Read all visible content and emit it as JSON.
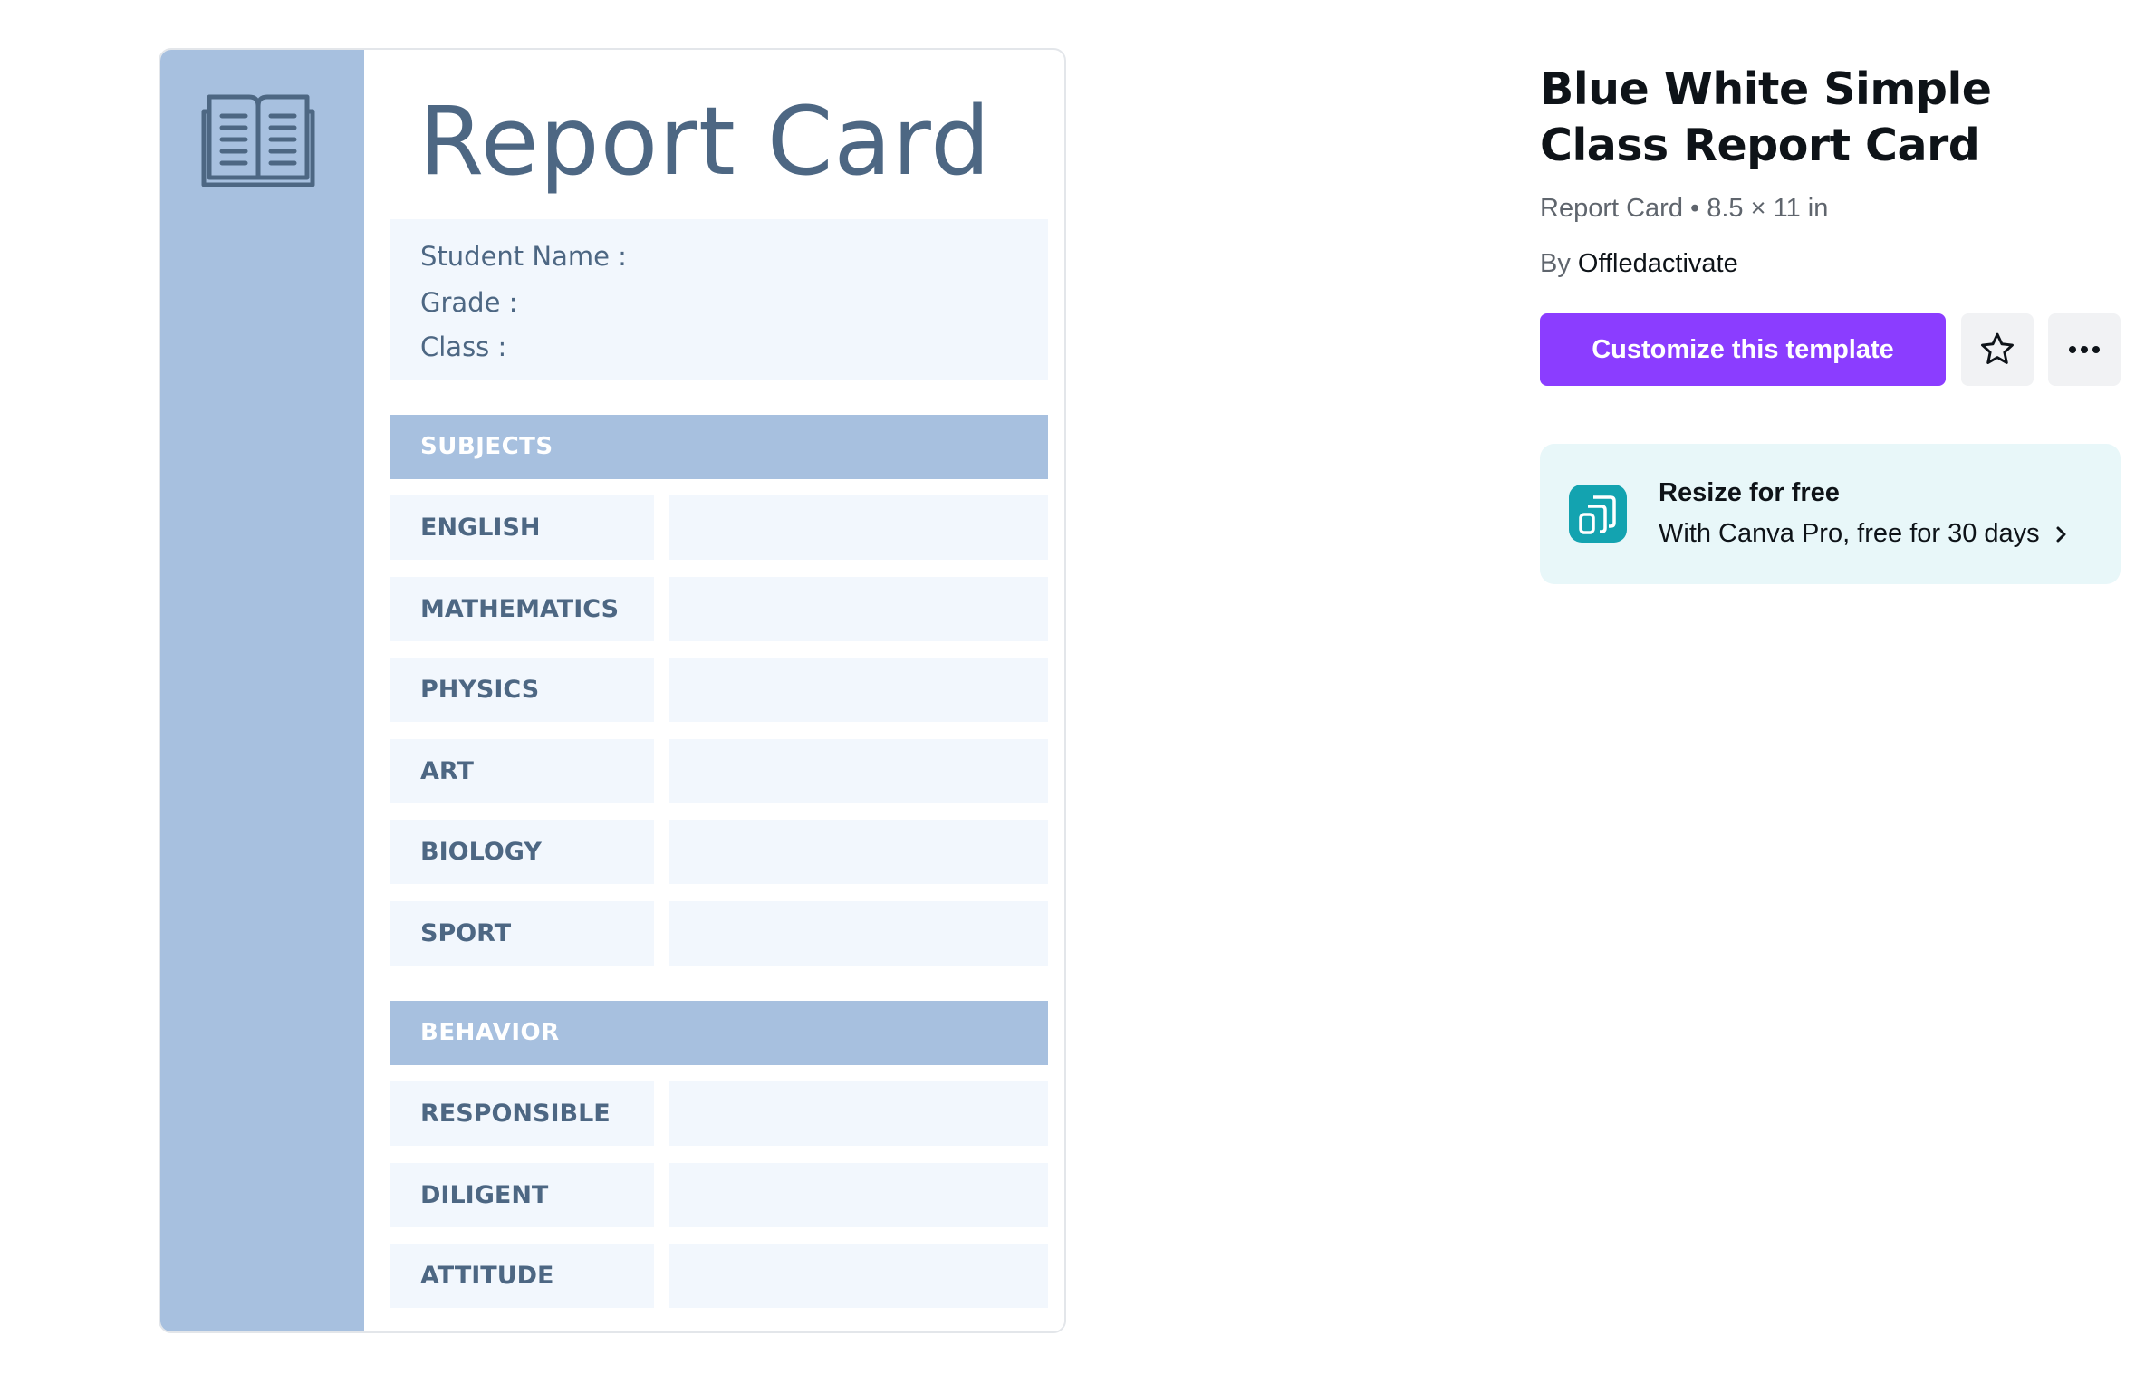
{
  "template_preview": {
    "title": "Report Card",
    "info_fields": [
      "Student Name :",
      "Grade :",
      "Class :"
    ],
    "sections": [
      {
        "heading": "SUBJECTS",
        "rows": [
          "ENGLISH",
          "MATHEMATICS",
          "PHYSICS",
          "ART",
          "BIOLOGY",
          "SPORT"
        ]
      },
      {
        "heading": "BEHAVIOR",
        "rows": [
          "RESPONSIBLE",
          "DILIGENT",
          "ATTITUDE"
        ]
      }
    ],
    "colors": {
      "sidebar": "#a7c0df",
      "text": "#4d6783",
      "cell": "#f2f7fd"
    }
  },
  "details": {
    "title": "Blue White Simple Class Report Card",
    "meta": "Report Card • 8.5 × 11 in",
    "author_prefix": "By",
    "author_name": "Offledactivate",
    "customize_label": "Customize this template",
    "favorite_icon": "star-icon",
    "more_icon": "more-horizontal-icon",
    "promo": {
      "icon": "resize-icon",
      "title": "Resize for free",
      "subtitle": "With Canva Pro, free for 30 days",
      "chevron_icon": "chevron-right-icon"
    },
    "colors": {
      "primary": "#8b3dff",
      "promo_bg": "#e8f7f9",
      "promo_icon": "#13a3b0"
    }
  }
}
